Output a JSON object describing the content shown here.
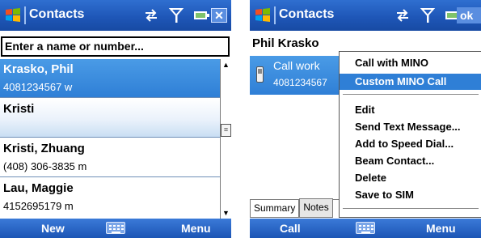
{
  "left": {
    "title": "Contacts",
    "search_placeholder": "Enter a name or number...",
    "contacts": [
      {
        "name": "Krasko, Phil",
        "detail": "4081234567   w"
      },
      {
        "name": "Kristi",
        "detail": ""
      },
      {
        "name": "Kristi, Zhuang",
        "detail": "(408) 306-3835   m"
      },
      {
        "name": "Lau, Maggie",
        "detail": "4152695179   m"
      }
    ],
    "softkeys": {
      "left": "New",
      "right": "Menu"
    }
  },
  "right": {
    "title": "Contacts",
    "ok_label": "ok",
    "contact_name": "Phil Krasko",
    "detail_label": "Call work",
    "detail_value": "4081234567",
    "tabs": [
      "Summary",
      "Notes"
    ],
    "menu": [
      "Call with MINO",
      "Custom MINO Call",
      "Edit",
      "Send Text Message...",
      "Add to Speed Dial...",
      "Beam Contact...",
      "Delete",
      "Save to SIM"
    ],
    "softkeys": {
      "left": "Call",
      "right": "Menu"
    }
  },
  "icons": {
    "start": "windows-start-icon",
    "connectivity": "connectivity-icon",
    "signal": "signal-strength-icon",
    "battery": "battery-icon",
    "keyboard": "keyboard-icon",
    "phone": "phone-icon"
  },
  "colors": {
    "titlebar": "#1f57b8",
    "selection": "#2f7fd6",
    "softkey_bar": "#1c55b5"
  }
}
